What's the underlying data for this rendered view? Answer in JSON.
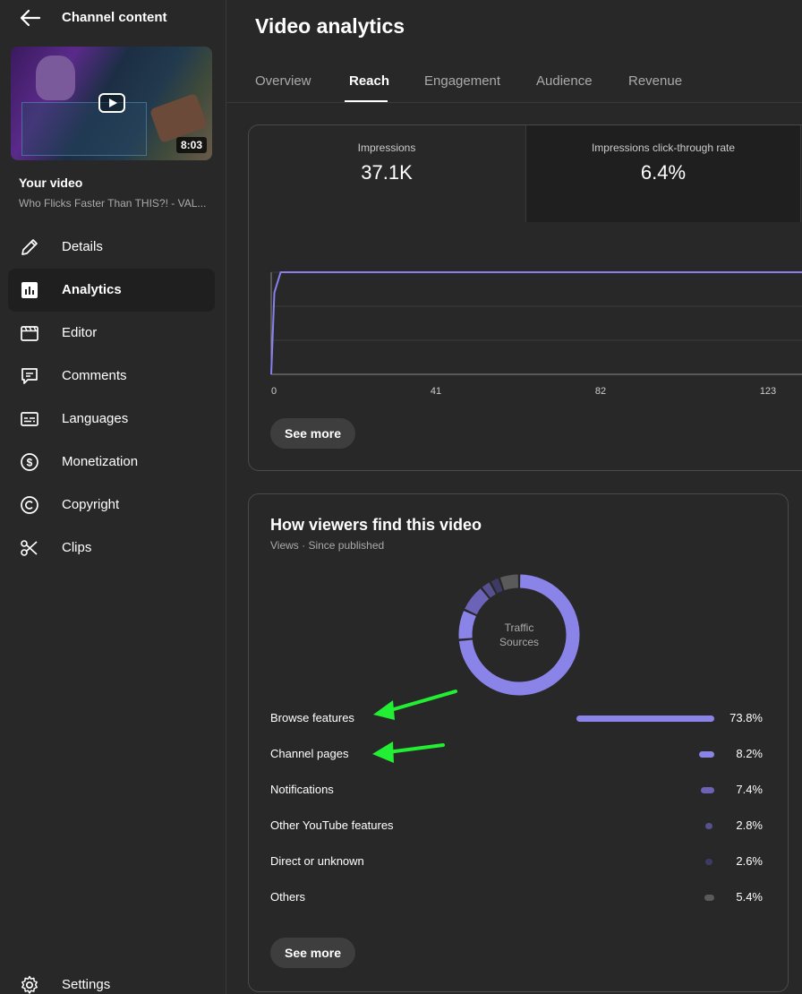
{
  "sidebar": {
    "title": "Channel content",
    "your_video_label": "Your video",
    "video_title": "Who Flicks Faster Than THIS?! - VAL...",
    "duration": "8:03",
    "items": [
      {
        "label": "Details",
        "icon": "pencil-icon"
      },
      {
        "label": "Analytics",
        "icon": "analytics-icon",
        "active": true
      },
      {
        "label": "Editor",
        "icon": "clapperboard-icon"
      },
      {
        "label": "Comments",
        "icon": "comment-icon"
      },
      {
        "label": "Languages",
        "icon": "subtitles-icon"
      },
      {
        "label": "Monetization",
        "icon": "dollar-icon"
      },
      {
        "label": "Copyright",
        "icon": "copyright-icon"
      },
      {
        "label": "Clips",
        "icon": "scissors-icon"
      }
    ],
    "settings_label": "Settings"
  },
  "main": {
    "title": "Video analytics",
    "tabs": [
      "Overview",
      "Reach",
      "Engagement",
      "Audience",
      "Revenue"
    ],
    "active_tab": "Reach"
  },
  "reach_card": {
    "metrics": [
      {
        "label": "Impressions",
        "value": "37.1K"
      },
      {
        "label": "Impressions click-through rate",
        "value": "6.4%"
      }
    ],
    "see_more": "See more"
  },
  "chart_data": {
    "type": "line",
    "x_ticks": [
      "0",
      "41",
      "82",
      "123"
    ],
    "series": [
      {
        "values": [
          [
            0,
            0.0
          ],
          [
            1,
            0.8
          ],
          [
            3,
            1.0
          ],
          [
            175,
            1.0
          ]
        ],
        "color": "#8a7ff0"
      }
    ],
    "grid": true
  },
  "traffic": {
    "title": "How viewers find this video",
    "subtitle": "Views · Since published",
    "donut_label_line1": "Traffic",
    "donut_label_line2": "Sources",
    "sources": [
      {
        "name": "Browse features",
        "pct_label": "73.8%",
        "pct": 73.8,
        "color": "#8a83e8"
      },
      {
        "name": "Channel pages",
        "pct_label": "8.2%",
        "pct": 8.2,
        "color": "#8a83e8"
      },
      {
        "name": "Notifications",
        "pct_label": "7.4%",
        "pct": 7.4,
        "color": "#6b63b8"
      },
      {
        "name": "Other YouTube features",
        "pct_label": "2.8%",
        "pct": 2.8,
        "color": "#56508f"
      },
      {
        "name": "Direct or unknown",
        "pct_label": "2.6%",
        "pct": 2.6,
        "color": "#3e3a66"
      },
      {
        "name": "Others",
        "pct_label": "5.4%",
        "pct": 5.4,
        "color": "#5a5a5a"
      }
    ],
    "see_more": "See more"
  },
  "colors": {
    "accent": "#8a83e8",
    "annotation_arrow": "#22ee33"
  }
}
